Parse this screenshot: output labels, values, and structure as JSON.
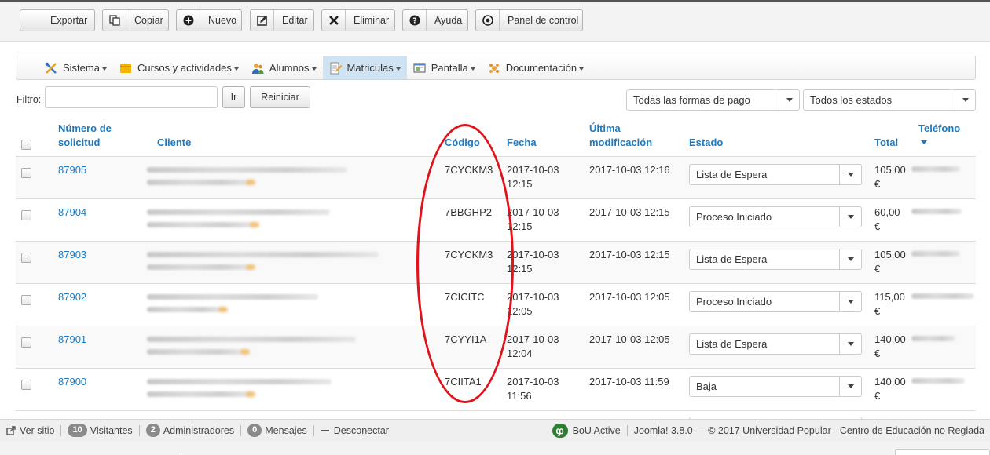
{
  "toolbar": {
    "buttons": [
      {
        "label": "Exportar",
        "icon": "export-icon"
      },
      {
        "label": "Copiar",
        "icon": "copy-icon"
      },
      {
        "label": "Nuevo",
        "icon": "plus-circle-icon"
      },
      {
        "label": "Editar",
        "icon": "edit-icon"
      },
      {
        "label": "Eliminar",
        "icon": "x-icon"
      },
      {
        "label": "Ayuda",
        "icon": "question-icon"
      },
      {
        "label": "Panel de control",
        "icon": "info-icon"
      }
    ]
  },
  "menu": {
    "items": [
      {
        "label": "Sistema",
        "icon": "tools-icon"
      },
      {
        "label": "Cursos y actividades",
        "icon": "folder-icon"
      },
      {
        "label": "Alumnos",
        "icon": "users-icon"
      },
      {
        "label": "Matriculas",
        "icon": "document-edit-icon",
        "active": true
      },
      {
        "label": "Pantalla",
        "icon": "screen-icon"
      },
      {
        "label": "Documentación",
        "icon": "docs-gear-icon"
      }
    ]
  },
  "filter": {
    "label": "Filtro:",
    "value": "",
    "go_label": "Ir",
    "reset_label": "Reiniciar",
    "payment_select": "Todas las formas de pago",
    "status_select": "Todos los estados"
  },
  "table": {
    "headers": {
      "number": "Número de solicitud",
      "client": "Cliente",
      "code": "Código",
      "date": "Fecha",
      "modified": "Última modificación",
      "status": "Estado",
      "total": "Total",
      "phone": "Teléfono"
    },
    "rows": [
      {
        "number": "87905",
        "code": "7CYCKM3",
        "date": "2017-10-03 12:15",
        "modified": "2017-10-03 12:16",
        "status": "Lista de Espera",
        "total": "105,00 €"
      },
      {
        "number": "87904",
        "code": "7BBGHP2",
        "date": "2017-10-03 12:15",
        "modified": "2017-10-03 12:15",
        "status": "Proceso Iniciado",
        "total": "60,00 €"
      },
      {
        "number": "87903",
        "code": "7CYCKM3",
        "date": "2017-10-03 12:15",
        "modified": "2017-10-03 12:15",
        "status": "Lista de Espera",
        "total": "105,00 €"
      },
      {
        "number": "87902",
        "code": "7CICITC",
        "date": "2017-10-03 12:05",
        "modified": "2017-10-03 12:05",
        "status": "Proceso Iniciado",
        "total": "115,00 €"
      },
      {
        "number": "87901",
        "code": "7CYYI1A",
        "date": "2017-10-03 12:04",
        "modified": "2017-10-03 12:05",
        "status": "Lista de Espera",
        "total": "140,00 €"
      },
      {
        "number": "87900",
        "code": "7CIITA1",
        "date": "2017-10-03 11:56",
        "modified": "2017-10-03 11:59",
        "status": "Baja",
        "total": "140,00 €"
      }
    ]
  },
  "statusbar": {
    "view_site": "Ver sitio",
    "visitors_count": "10",
    "visitors_label": "Visitantes",
    "admins_count": "2",
    "admins_label": "Administradores",
    "messages_count": "0",
    "messages_label": "Mensajes",
    "logout": "Desconectar",
    "bou": "BoU Active",
    "footer": "Joomla! 3.8.0 — © 2017 Universidad Popular - Centro de Educación no Reglada"
  },
  "colors": {
    "link": "#1c7bc2",
    "highlight_ellipse": "#e0121b",
    "active_menu": "#cfe3f3"
  }
}
